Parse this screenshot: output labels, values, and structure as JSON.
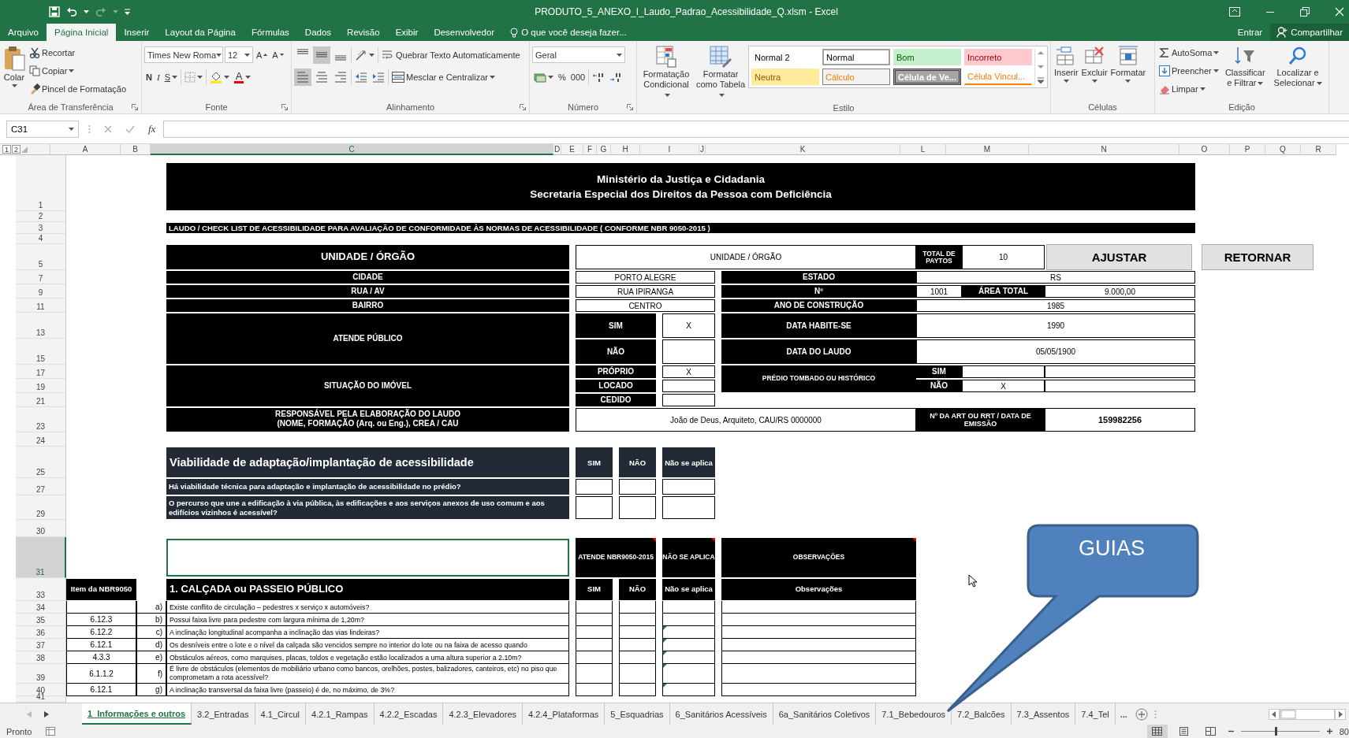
{
  "window": {
    "title": "PRODUTO_5_ANEXO_I_Laudo_Padrao_Acessibilidade_Q.xlsm - Excel"
  },
  "ribbon_tabs": [
    {
      "label": "Arquivo",
      "selected": false
    },
    {
      "label": "Página Inicial",
      "selected": true
    },
    {
      "label": "Inserir",
      "selected": false
    },
    {
      "label": "Layout da Página",
      "selected": false
    },
    {
      "label": "Fórmulas",
      "selected": false
    },
    {
      "label": "Dados",
      "selected": false
    },
    {
      "label": "Revisão",
      "selected": false
    },
    {
      "label": "Exibir",
      "selected": false
    },
    {
      "label": "Desenvolvedor",
      "selected": false
    }
  ],
  "tell_me": {
    "placeholder": "O que você deseja fazer..."
  },
  "account": {
    "sign_in": "Entrar",
    "share": "Compartilhar"
  },
  "ribbon": {
    "clipboard": {
      "paste": "Colar",
      "cut": "Recortar",
      "copy": "Copiar",
      "format_painter": "Pincel de Formatação",
      "label": "Área de Transferência"
    },
    "font": {
      "name": "Times New Roma",
      "size": "12",
      "grow": "A",
      "shrink": "A",
      "bold": "N",
      "italic": "I",
      "underline": "S",
      "text_color_button": "A",
      "label": "Fonte"
    },
    "alignment": {
      "vertical": [
        {
          "kind": "top",
          "selected": false
        },
        {
          "kind": "middle",
          "selected": true
        },
        {
          "kind": "bottom",
          "selected": false
        }
      ],
      "horizontal": [
        {
          "kind": "left",
          "selected": true
        },
        {
          "kind": "center",
          "selected": false
        },
        {
          "kind": "right",
          "selected": false
        }
      ],
      "wrap": "Quebrar Texto Automaticamente",
      "merge": "Mesclar e Centralizar",
      "label": "Alinhamento"
    },
    "number": {
      "format": "Geral",
      "percent": "%",
      "thousands": "000",
      "label": "Número"
    },
    "styles": {
      "conditional": "Formatação Condicional",
      "as_table": "Formatar como Tabela",
      "label": "Estilo",
      "gallery": [
        {
          "name": "Normal 2",
          "kind": "plain",
          "selected": false
        },
        {
          "name": "Normal",
          "kind": "plain",
          "selected": true
        },
        {
          "name": "Bom",
          "kind": "good",
          "selected": false
        },
        {
          "name": "Incorreto",
          "kind": "bad",
          "selected": false
        },
        {
          "name": "Neutra",
          "kind": "neutral",
          "selected": false
        },
        {
          "name": "Cálculo",
          "kind": "calculation",
          "selected": false
        },
        {
          "name": "Célula de Ve...",
          "kind": "check",
          "selected": false
        },
        {
          "name": "Célula Vincul...",
          "kind": "linked",
          "selected": false
        }
      ]
    },
    "cells": {
      "buttons": [
        "Inserir",
        "Excluir",
        "Formatar"
      ],
      "label": "Células"
    },
    "editing": {
      "autosum": "AutoSoma",
      "fill": "Preencher",
      "clear": "Limpar",
      "sort": "Classificar e Filtrar",
      "find": "Localizar e Selecionar",
      "label": "Edição"
    }
  },
  "formula_bar": {
    "name_box": "C31",
    "function_label": "fx"
  },
  "sheet": {
    "outline_levels": [
      "1",
      "2"
    ],
    "columns": [
      {
        "label": "A",
        "selected": false
      },
      {
        "label": "B",
        "selected": false
      },
      {
        "label": "C",
        "selected": true
      },
      {
        "label": "D",
        "selected": false
      },
      {
        "label": "E",
        "selected": false
      },
      {
        "label": "F",
        "selected": false
      },
      {
        "label": "G",
        "selected": false
      },
      {
        "label": "H",
        "selected": false
      },
      {
        "label": "I",
        "selected": false
      },
      {
        "label": "J",
        "selected": false
      },
      {
        "label": "K",
        "selected": false
      },
      {
        "label": "L",
        "selected": false
      },
      {
        "label": "M",
        "selected": false
      },
      {
        "label": "N",
        "selected": false
      },
      {
        "label": "O",
        "selected": false
      },
      {
        "label": "P",
        "selected": false
      },
      {
        "label": "Q",
        "selected": false
      },
      {
        "label": "R",
        "selected": false
      }
    ],
    "rows": [
      {
        "label": "1",
        "selected": false
      },
      {
        "label": "2",
        "selected": false
      },
      {
        "label": "3",
        "selected": false
      },
      {
        "label": "4",
        "selected": false
      },
      {
        "label": "5",
        "selected": false
      },
      {
        "label": "7",
        "selected": false
      },
      {
        "label": "9",
        "selected": false
      },
      {
        "label": "11",
        "selected": false
      },
      {
        "label": "13",
        "selected": false
      },
      {
        "label": "15",
        "selected": false
      },
      {
        "label": "17",
        "selected": false
      },
      {
        "label": "19",
        "selected": false
      },
      {
        "label": "21",
        "selected": false
      },
      {
        "label": "23",
        "selected": false
      },
      {
        "label": "24",
        "selected": false
      },
      {
        "label": "25",
        "selected": false
      },
      {
        "label": "27",
        "selected": false
      },
      {
        "label": "29",
        "selected": false
      },
      {
        "label": "30",
        "selected": false
      },
      {
        "label": "31",
        "selected": true
      },
      {
        "label": "33",
        "selected": false
      },
      {
        "label": "34",
        "selected": false
      },
      {
        "label": "35",
        "selected": false
      },
      {
        "label": "36",
        "selected": false
      },
      {
        "label": "37",
        "selected": false
      },
      {
        "label": "38",
        "selected": false
      },
      {
        "label": "39",
        "selected": false
      },
      {
        "label": "40",
        "selected": false
      },
      {
        "label": "41",
        "selected": false
      }
    ],
    "banner": [
      "Ministério da Justiça e Cidadania",
      "Secretaria Especial dos Direitos da Pessoa com Deficiência"
    ],
    "subtitle": "LAUDO / CHECK LIST DE ACESSIBILIDADE PARA AVALIAÇÃO DE CONFORMIDADE ÀS NORMAS DE ACESSIBILIDADE ( CONFORME NBR 9050-2015 )",
    "unit": {
      "label": "UNIDADE / ÓRGÃO",
      "value": "UNIDADE / ÓRGÃO"
    },
    "total": {
      "label": "TOTAL DE PAYTOS",
      "value": "10"
    },
    "buttons": [
      "AJUSTAR",
      "RETORNAR"
    ],
    "address": [
      {
        "label": "CIDADE",
        "value": "PORTO ALEGRE"
      },
      {
        "label": "RUA / AV",
        "value": "RUA IPIRANGA"
      },
      {
        "label": "BAIRRO",
        "value": "CENTRO"
      }
    ],
    "state": {
      "label": "ESTADO",
      "value": "RS"
    },
    "number": {
      "label": "Nº",
      "value": "1001"
    },
    "area": {
      "label": "ÁREA TOTAL",
      "value": "9.000,00"
    },
    "year": {
      "label": "ANO DE CONSTRUÇÃO",
      "value": "1985"
    },
    "public": {
      "label": "ATENDE PÚBLICO",
      "options": [
        {
          "label": "SIM",
          "mark": "X"
        },
        {
          "label": "NÃO"
        }
      ]
    },
    "dates": [
      {
        "label": "DATA HABITE-SE",
        "value": "1990"
      },
      {
        "label": "DATA DO LAUDO",
        "value": "05/05/1900"
      }
    ],
    "situation": {
      "label": "SITUAÇÃO DO IMÓVEL",
      "options": [
        {
          "label": "PRÓPRIO",
          "mark": "X"
        },
        {
          "label": "LOCADO"
        },
        {
          "label": "CEDIDO"
        }
      ]
    },
    "heritage": {
      "label": "PRÉDIO TOMBADO OU HISTÓRICO",
      "options": [
        {
          "label": "SIM"
        },
        {
          "label": "NÃO",
          "mark": "X"
        }
      ]
    },
    "responsible": {
      "label_lines": [
        "RESPONSÁVEL PELA ELABORAÇÃO DO LAUDO",
        "(NOME, FORMAÇÃO (Arq. ou Eng.), CREA / CAU"
      ],
      "value": "João de Deus, Arquiteto, CAU/RS 0000000"
    },
    "art": {
      "label": "Nº DA ART OU RRT / DATA DE EMISSÃO",
      "value": "159982256"
    },
    "viability": {
      "title": "Viabilidade de adaptação/implantação de acessibilidade",
      "columns": [
        "SIM",
        "NÃO",
        "Não se aplica"
      ],
      "questions": [
        "Há viabilidade técnica para adaptação e implantação de acessibilidade no prédio?",
        " O percurso que une a edificação à via pública, às edificações e aos serviços anexos de uso comum e aos edifícios vizinhos é acessível?"
      ]
    },
    "checklist": {
      "note_cell": {
        "selected": true
      },
      "group_headers": [
        {
          "label": "ATENDE NBR9050-2015",
          "comment": true
        },
        {
          "label": "NÃO SE APLICA",
          "comment": true
        },
        {
          "label": "OBSERVAÇÕES",
          "comment": true
        }
      ],
      "item_header": "Item da NBR9050",
      "section_title": "1. CALÇADA ou PASSEIO PÚBLICO",
      "columns": [
        "SIM",
        "NÃO",
        "Não se aplica",
        "Observações"
      ],
      "items": [
        {
          "letter": "a)",
          "text": "Existe conflito de circulação – pedestres x serviço x automóveis?",
          "flagged": false
        },
        {
          "ref": "6.12.3",
          "letter": "b)",
          "text": " Possui faixa livre para pedestre com largura mínima de 1,20m?",
          "flagged": false
        },
        {
          "ref": "6.12.2",
          "letter": "c)",
          "text": " A inclinação longitudinal acompanha a inclinação das vias lindeiras?",
          "flagged": true
        },
        {
          "ref": "6.12.1",
          "letter": "d)",
          "text": "Os desníveis entre o lote e o nível da calçada são vencidos sempre no interior do lote ou na faixa de acesso quando",
          "flagged": true
        },
        {
          "ref": "4.3.3",
          "letter": "e)",
          "text": "Obstáculos aéreos, como marquises, placas, toldos e vegetação estão localizados a uma altura superior a 2.10m?",
          "flagged": true
        },
        {
          "ref": "6.1.1.2",
          "letter": "f)",
          "text": "É livre de obstáculos (elementos de mobiliário urbano como bancos, orelhões, postes, balizadores, canteiros, etc) no piso que comprometam a rota acessível?",
          "flagged": true
        },
        {
          "ref": "6.12.1",
          "letter": "g)",
          "text": "A inclinação transversal da faixa livre (passeio) é de, no máximo, de 3%?",
          "flagged": true
        }
      ]
    }
  },
  "sheet_tabs": [
    {
      "label": "1_Informações e outros",
      "selected": true
    },
    {
      "label": "3.2_Entradas",
      "selected": false
    },
    {
      "label": "4.1_Circul",
      "selected": false
    },
    {
      "label": "4.2.1_Rampas",
      "selected": false
    },
    {
      "label": "4.2.2_Escadas",
      "selected": false
    },
    {
      "label": "4.2.3_Elevadores",
      "selected": false
    },
    {
      "label": "4.2.4_Plataformas",
      "selected": false
    },
    {
      "label": "5_Esquadrias",
      "selected": false
    },
    {
      "label": "6_Sanitários Acessíveis",
      "selected": false
    },
    {
      "label": "6a_Sanitários Coletivos",
      "selected": false
    },
    {
      "label": "7.1_Bebedouros",
      "selected": false
    },
    {
      "label": "7.2_Balcões",
      "selected": false
    },
    {
      "label": "7.3_Assentos",
      "selected": false
    },
    {
      "label": "7.4_Tel",
      "selected": false
    }
  ],
  "more_tabs": "...",
  "status": {
    "text": "Pronto",
    "views": [
      {
        "kind": "normal",
        "selected": true
      },
      {
        "kind": "page_layout",
        "selected": false
      },
      {
        "kind": "page_break",
        "selected": false
      }
    ],
    "zoom_slider": {
      "level": 0.45
    },
    "zoom": "80"
  },
  "callout": {
    "text": "GUIAS"
  }
}
